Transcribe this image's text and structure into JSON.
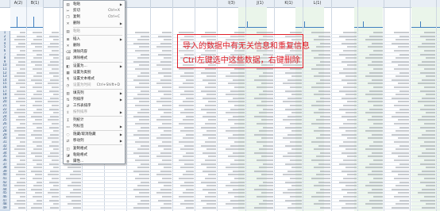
{
  "sheet": {
    "columns": [
      "A(2)",
      "B(1)",
      "",
      "",
      "",
      "",
      "",
      "",
      "",
      "",
      "I(3)",
      "J(1)",
      "K(1)",
      "L(1)",
      "",
      "",
      "",
      "",
      "",
      ""
    ],
    "row_numbers": [
      "1",
      "2",
      "3",
      "4",
      "5",
      "6",
      "7",
      "8",
      "9",
      "10",
      "11",
      "12",
      "13",
      "14",
      "15",
      "16",
      "17",
      "18",
      "19",
      "20",
      "21",
      "22",
      "23",
      "24",
      "25",
      "26",
      "27",
      "28",
      "29",
      "30",
      "31",
      "32",
      "33",
      "34",
      "35",
      "36",
      "37",
      "38",
      "39",
      "40",
      "41",
      "42",
      "43",
      "44",
      "45",
      "46",
      "47",
      "48",
      "49"
    ]
  },
  "context_menu": {
    "items": [
      {
        "label": "粘贴",
        "shortcut": "",
        "icon": "paste-icon",
        "arrow": true,
        "dim": false
      },
      {
        "label": "剪切",
        "shortcut": "Ctrl+X",
        "icon": "cut-icon",
        "arrow": false,
        "dim": false
      },
      {
        "label": "复制",
        "shortcut": "Ctrl+C",
        "icon": "copy-icon",
        "arrow": false,
        "dim": false
      },
      {
        "label": "删除",
        "shortcut": "",
        "icon": "delete-icon",
        "arrow": true,
        "dim": false
      },
      {
        "label": "粘贴",
        "shortcut": "",
        "icon": "paste-icon",
        "arrow": false,
        "dim": true
      },
      {
        "label": "插入",
        "shortcut": "",
        "icon": "insert-icon",
        "arrow": true,
        "dim": false
      },
      {
        "label": "删除",
        "shortcut": "",
        "icon": "delete-icon",
        "arrow": false,
        "dim": false
      },
      {
        "label": "清除内容",
        "shortcut": "",
        "icon": "clear-icon",
        "arrow": false,
        "dim": false
      },
      {
        "label": "清除格式",
        "shortcut": "",
        "icon": "clear-format-icon",
        "arrow": false,
        "dim": false
      },
      {
        "label": "设置为...",
        "shortcut": "",
        "icon": "set-icon",
        "arrow": true,
        "dim": false
      },
      {
        "label": "设置为类别",
        "shortcut": "",
        "icon": "category-icon",
        "arrow": false,
        "dim": false
      },
      {
        "label": "设置文本格式",
        "shortcut": "",
        "icon": "format-icon",
        "arrow": false,
        "dim": false
      },
      {
        "label": "设置为时间",
        "shortcut": "Ctrl+Shift+D",
        "icon": "time-icon",
        "arrow": false,
        "dim": true
      },
      {
        "label": "填充列",
        "shortcut": "",
        "icon": "fill-icon",
        "arrow": true,
        "dim": false
      },
      {
        "label": "列排序",
        "shortcut": "",
        "icon": "sort-icon",
        "arrow": true,
        "dim": false
      },
      {
        "label": "工作表排序",
        "shortcut": "",
        "icon": "sort-sheet-icon",
        "arrow": false,
        "dim": false
      },
      {
        "label": "按列排序",
        "shortcut": "",
        "icon": "sort-column-icon",
        "arrow": true,
        "dim": true
      },
      {
        "label": "列统计",
        "shortcut": "",
        "icon": "stats-icon",
        "arrow": false,
        "dim": false
      },
      {
        "label": "列标签",
        "shortcut": "",
        "icon": "label-icon",
        "arrow": true,
        "dim": false
      },
      {
        "label": "隐藏/取消隐藏",
        "shortcut": "",
        "icon": "hide-icon",
        "arrow": true,
        "dim": false
      },
      {
        "label": "移动列",
        "shortcut": "",
        "icon": "move-icon",
        "arrow": true,
        "dim": false
      },
      {
        "label": "复制格式",
        "shortcut": "",
        "icon": "copy-format-icon",
        "arrow": false,
        "dim": false
      },
      {
        "label": "粘贴格式",
        "shortcut": "",
        "icon": "paste-format-icon",
        "arrow": false,
        "dim": false
      },
      {
        "label": "属性...",
        "shortcut": "",
        "icon": "properties-icon",
        "arrow": false,
        "dim": false
      }
    ]
  },
  "callout": {
    "line1": "导入的数据中有无关信息和重复信息",
    "line2": "Ctrl左键选中这些数据，右键删除"
  },
  "colors": {
    "accent": "#e0202a",
    "header_bg": "#e8eef5",
    "green_band": "#eaf5ea"
  }
}
